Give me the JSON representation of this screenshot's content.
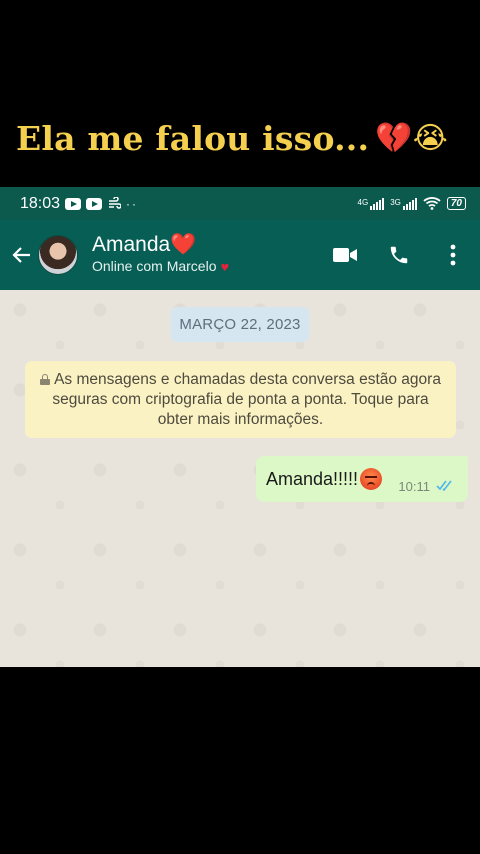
{
  "caption": {
    "text": "Ela me falou isso...",
    "emojis": "💔😭"
  },
  "status_bar": {
    "time": "18:03",
    "network_1": "4G",
    "network_2": "3G",
    "battery": "70"
  },
  "header": {
    "contact_name": "Amanda",
    "name_emoji": "❤️",
    "status": "Online com Marcelo",
    "status_emoji": "♥"
  },
  "chat": {
    "date_chip": "MARÇO 22, 2023",
    "encryption_notice": "As mensagens e chamadas desta conversa estão agora seguras com criptografia de ponta a ponta. Toque para obter mais informações.",
    "messages": [
      {
        "direction": "outgoing",
        "text": "Amanda!!!!!",
        "emoji": "angry-face-icon",
        "time": "10:11",
        "status": "read"
      }
    ]
  },
  "colors": {
    "caption": "#f5d04e",
    "status_bar": "#0b5a4d",
    "app_bar": "#075e54",
    "outgoing_bubble": "#dcf8c6",
    "notice_bg": "#fbf2c4",
    "date_chip_bg": "#d6e6f0",
    "read_ticks": "#4fb6ec"
  }
}
